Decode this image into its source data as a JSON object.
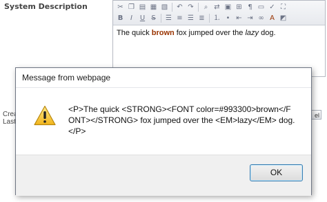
{
  "page": {
    "section_label": "System Description",
    "behind_text_1": "Crea",
    "behind_text_2": "Last",
    "behind_button": "el"
  },
  "editor": {
    "content": {
      "part1": "The quick ",
      "brown": "brown",
      "part2": " fox jumped over the ",
      "lazy": "lazy",
      "part3": " dog."
    },
    "toolbar_icons": {
      "row1": [
        "cut-icon",
        "copy-icon",
        "paste-icon",
        "paste-text-icon",
        "paste-word-icon",
        "undo-icon",
        "redo-icon",
        "find-icon",
        "replace-icon",
        "select-all-icon",
        "insert-table-icon",
        "format-icon",
        "image-icon",
        "spellcheck-icon",
        "fullscreen-icon"
      ],
      "row2": [
        "bold-icon",
        "italic-icon",
        "underline-icon",
        "strike-icon",
        "align-left-icon",
        "align-center-icon",
        "align-right-icon",
        "justify-icon",
        "numbered-list-icon",
        "bullet-list-icon",
        "outdent-icon",
        "indent-icon",
        "link-icon",
        "font-color-icon",
        "bg-color-icon"
      ]
    },
    "accent_brown": "#993300"
  },
  "dialog": {
    "title": "Message from webpage",
    "message": "<P>The quick <STRONG><FONT color=#993300>brown</FONT></STRONG> fox jumped over the <EM>lazy</EM> dog.</P>",
    "ok_label": "OK",
    "icon": "warning-icon"
  }
}
